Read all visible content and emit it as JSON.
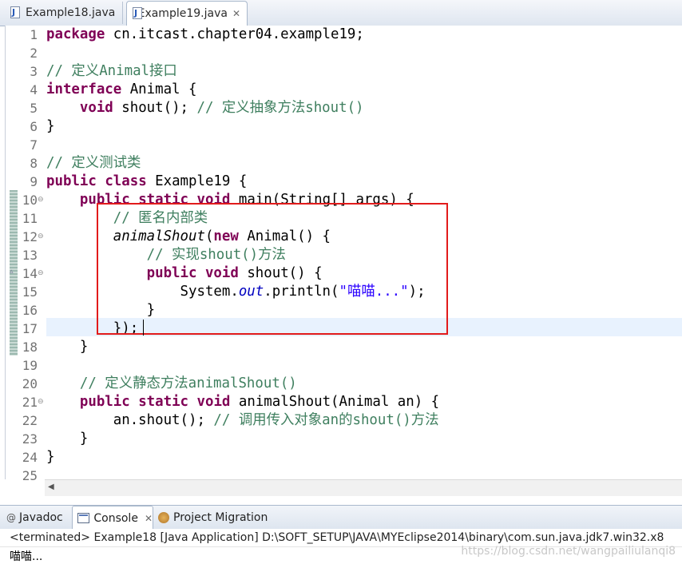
{
  "editor_tabs": [
    {
      "label": "Example18.java",
      "active": false
    },
    {
      "label": "Example19.java",
      "active": true,
      "close": "✕"
    }
  ],
  "line_numbers": [
    "1",
    "2",
    "3",
    "4",
    "5",
    "6",
    "7",
    "8",
    "9",
    "10",
    "11",
    "12",
    "13",
    "14",
    "15",
    "16",
    "17",
    "18",
    "19",
    "20",
    "21",
    "22",
    "23",
    "24",
    "25"
  ],
  "code": {
    "l1_kw": "package",
    "l1_rest": " cn.itcast.chapter04.example19;",
    "l3_cm": "// 定义Animal接口",
    "l4_kw": "interface",
    "l4_rest": " Animal {",
    "l5_kw": "void",
    "l5_rest": " shout(); ",
    "l5_cm": "// 定义抽象方法shout()",
    "l6": "}",
    "l8_cm": "// 定义测试类",
    "l9_kw1": "public",
    "l9_kw2": "class",
    "l9_rest": " Example19 {",
    "l10_kw1": "public",
    "l10_kw2": "static",
    "l10_kw3": "void",
    "l10_rest": " main(String[] args) {",
    "l11_cm": "// 匿名内部类",
    "l12_it": "animalShout",
    "l12_a": "(",
    "l12_kw": "new",
    "l12_rest": " Animal() {",
    "l13_cm": "// 实现shout()方法",
    "l14_kw1": "public",
    "l14_kw2": "void",
    "l14_rest": " shout() {",
    "l15_a": "System.",
    "l15_fld": "out",
    "l15_b": ".println(",
    "l15_str": "\"喵喵...\"",
    "l15_c": ");",
    "l16": "}",
    "l17": "});",
    "l18": "}",
    "l20_cm": "// 定义静态方法animalShout()",
    "l21_kw1": "public",
    "l21_kw2": "static",
    "l21_kw3": "void",
    "l21_rest": " animalShout(Animal an) {",
    "l22_a": "an.shout(); ",
    "l22_cm": "// 调用传入对象an的shout()方法",
    "l23": "}",
    "l24": "}"
  },
  "view_tabs": [
    {
      "label": "Javadoc",
      "icon": "at-icon"
    },
    {
      "label": "Console",
      "icon": "console-icon",
      "active": true,
      "close": "✕"
    },
    {
      "label": "Project Migration",
      "icon": "migration-icon"
    }
  ],
  "console": {
    "status": "<terminated> Example18 [Java Application] D:\\SOFT_SETUP\\JAVA\\MYEclipse2014\\binary\\com.sun.java.jdk7.win32.x8",
    "output": "喵喵..."
  },
  "watermark": "https://blog.csdn.net/wangpailiulanqi8",
  "colors": {
    "keyword": "#7f0055",
    "comment": "#3f7f5f",
    "string": "#2a00ff",
    "highlight_box": "#e21b1b",
    "current_line": "#e8f2fe"
  }
}
